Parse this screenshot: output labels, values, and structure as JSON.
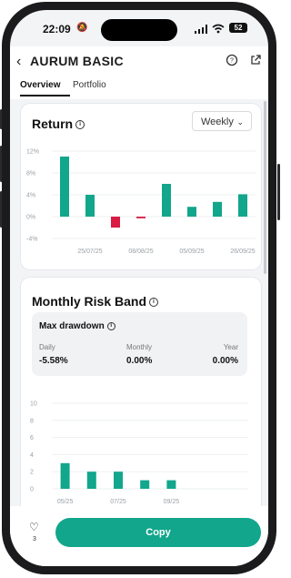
{
  "status": {
    "time": "22:09",
    "battery": "52"
  },
  "header": {
    "title": "AURUM BASIC",
    "tabs": [
      "Overview",
      "Portfolio"
    ],
    "active_tab": "Overview"
  },
  "return_card": {
    "title": "Return",
    "period_select": "Weekly",
    "chart_data": {
      "type": "bar",
      "categories": [
        "",
        "25/07/25",
        "",
        "08/08/25",
        "",
        "05/09/25",
        "",
        "26/09/25"
      ],
      "values": [
        11,
        4,
        -2,
        -0.3,
        6,
        1.8,
        2.7,
        4.1
      ],
      "y_ticks": [
        "12%",
        "8%",
        "4%",
        "0%",
        "-4%"
      ],
      "ylim": [
        -4,
        12
      ],
      "colors": {
        "positive": "#12a68c",
        "negative": "#d91a43"
      }
    }
  },
  "risk_card": {
    "title": "Monthly Risk Band",
    "max_drawdown": {
      "title": "Max drawdown",
      "daily_label": "Daily",
      "daily_value": "-5.58%",
      "monthly_label": "Monthly",
      "monthly_value": "0.00%",
      "year_label": "Year",
      "year_value": "0.00%"
    },
    "chart_data": {
      "type": "bar",
      "categories": [
        "05/25",
        "",
        "07/25",
        "",
        "09/25"
      ],
      "values": [
        3,
        2,
        2,
        1,
        1
      ],
      "y_ticks": [
        "10",
        "8",
        "6",
        "4",
        "2",
        "0"
      ],
      "ylim": [
        0,
        10
      ],
      "color": "#12a68c"
    }
  },
  "bottom": {
    "like_count": "3",
    "copy_label": "Copy"
  }
}
